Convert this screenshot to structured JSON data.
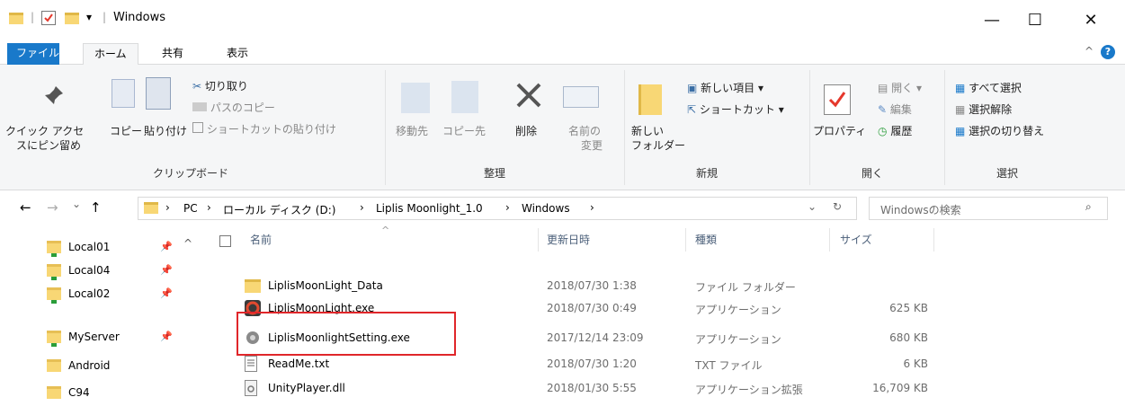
{
  "window": {
    "title": "Windows",
    "qa_sep": "|",
    "qa_arrow": "▾",
    "minimize_glyph": "—",
    "maximize_glyph": "☐",
    "close_glyph": "✕"
  },
  "ribbon_tabs": [
    "ファイル",
    "ホーム",
    "共有",
    "表示"
  ],
  "ribbon": {
    "clipboard": {
      "pin_label_1": "クイック アクセ",
      "pin_label_2": "スにピン留め",
      "copy": "コピー",
      "paste": "貼り付け",
      "cut": "切り取り",
      "copy_path": "パスのコピー",
      "paste_shortcut": "ショートカットの貼り付け",
      "group": "クリップボード"
    },
    "organize": {
      "move_to": "移動先",
      "copy_to": "コピー先",
      "delete": "削除",
      "rename_1": "名前の",
      "rename_2": "変更",
      "group": "整理"
    },
    "new": {
      "new_folder_1": "新しい",
      "new_folder_2": "フォルダー",
      "new_item": "新しい項目 ▾",
      "shortcut": "ショートカット ▾",
      "group": "新規"
    },
    "open": {
      "properties": "プロパティ",
      "open": "開く ▾",
      "edit": "編集",
      "history": "履歴",
      "group": "開く"
    },
    "select": {
      "select_all": "すべて選択",
      "select_none": "選択解除",
      "invert": "選択の切り替え",
      "group": "選択"
    }
  },
  "address": {
    "back": "←",
    "forward": "→",
    "recent": "⌄",
    "up": "↑",
    "crumbs": [
      "PC",
      "ローカル ディスク (D:)",
      "Liplis Moonlight_1.0",
      "Windows"
    ],
    "crumb_sep": "›",
    "dropdown": "⌄",
    "refresh": "↻",
    "search_placeholder": "Windowsの検索",
    "search_glyph": "⌕",
    "collapse_glyph": "^",
    "help_glyph": "?"
  },
  "nav_items": [
    {
      "label": "Local01",
      "pinned": true
    },
    {
      "label": "Local04",
      "pinned": true
    },
    {
      "label": "Local02",
      "pinned": true
    },
    {
      "label": "MyServer",
      "pinned": true
    },
    {
      "label": "Android",
      "pinned": false
    },
    {
      "label": "C94",
      "pinned": false
    }
  ],
  "pin_glyph": "📌",
  "columns": {
    "name": "名前",
    "date": "更新日時",
    "type": "種類",
    "size": "サイズ",
    "sort_glyph": "^"
  },
  "files": [
    {
      "name": "LiplisMoonLight_Data",
      "date": "2018/07/30 1:38",
      "type": "ファイル フォルダー",
      "size": "",
      "icon": "folder-icon"
    },
    {
      "name": "LiplisMoonLight.exe",
      "date": "2018/07/30 0:49",
      "type": "アプリケーション",
      "size": "625 KB",
      "icon": "app-icon"
    },
    {
      "name": "LiplisMoonlightSetting.exe",
      "date": "2017/12/14 23:09",
      "type": "アプリケーション",
      "size": "680 KB",
      "icon": "gear-icon"
    },
    {
      "name": "ReadMe.txt",
      "date": "2018/07/30 1:20",
      "type": "TXT ファイル",
      "size": "6 KB",
      "icon": "text-file-icon"
    },
    {
      "name": "UnityPlayer.dll",
      "date": "2018/01/30 5:55",
      "type": "アプリケーション拡張",
      "size": "16,709 KB",
      "icon": "dll-icon"
    }
  ],
  "colors": {
    "accent": "#1979ca",
    "highlight": "#e0262a",
    "folder": "#f8d775"
  }
}
